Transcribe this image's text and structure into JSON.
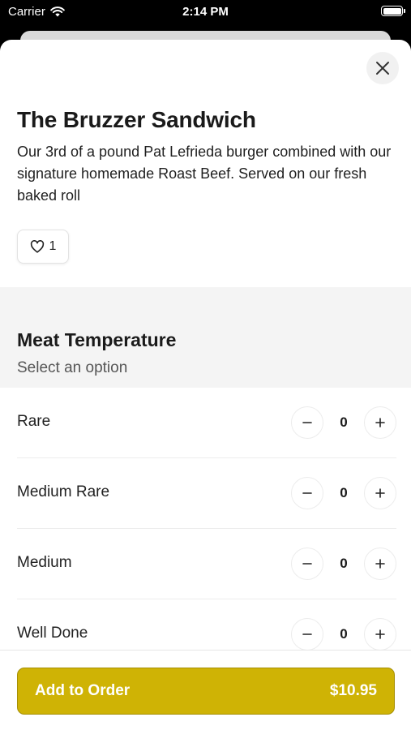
{
  "status_bar": {
    "carrier": "Carrier",
    "time": "2:14 PM"
  },
  "item": {
    "title": "The Bruzzer Sandwich",
    "description": "Our 3rd of a pound Pat Lefrieda burger combined with our signature homemade Roast Beef. Served on our fresh baked roll",
    "likes": "1"
  },
  "modifier_group": {
    "title": "Meat Temperature",
    "subtitle": "Select an option",
    "options": [
      {
        "label": "Rare",
        "quantity": "0"
      },
      {
        "label": "Medium Rare",
        "quantity": "0"
      },
      {
        "label": "Medium",
        "quantity": "0"
      },
      {
        "label": "Well Done",
        "quantity": "0"
      }
    ]
  },
  "footer": {
    "add_label": "Add to Order",
    "price": "$10.95"
  },
  "colors": {
    "accent": "#cfb305",
    "accent_border": "#a58f04",
    "section_bg": "#f4f4f4"
  }
}
